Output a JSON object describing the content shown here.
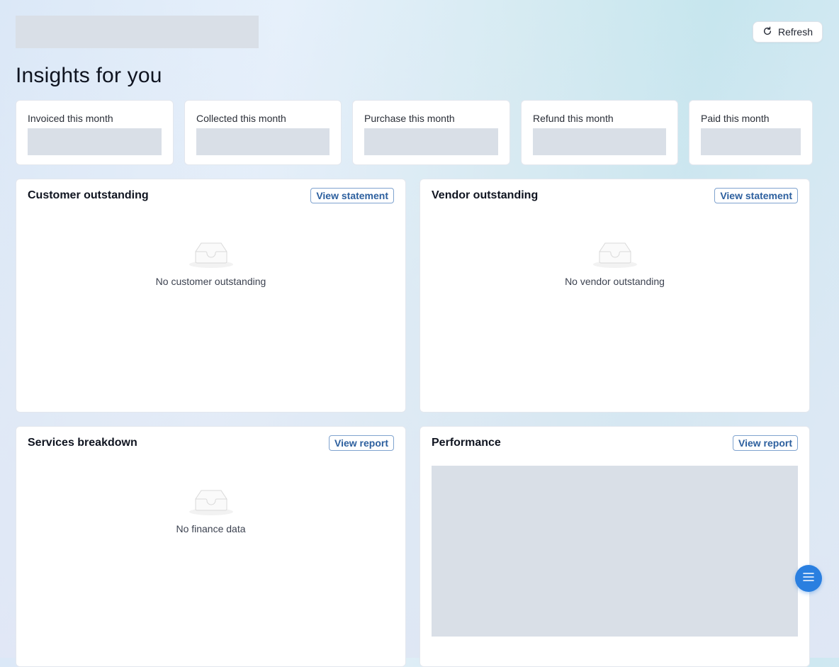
{
  "header": {
    "refresh_label": "Refresh",
    "title": "Insights for you"
  },
  "stats": [
    {
      "label": "Invoiced this month"
    },
    {
      "label": "Collected this month"
    },
    {
      "label": "Purchase this month"
    },
    {
      "label": "Refund this month"
    },
    {
      "label": "Paid this month"
    }
  ],
  "panels": {
    "customer": {
      "title": "Customer outstanding",
      "action": "View statement",
      "empty": "No customer outstanding"
    },
    "vendor": {
      "title": "Vendor outstanding",
      "action": "View statement",
      "empty": "No vendor outstanding"
    },
    "services": {
      "title": "Services breakdown",
      "action": "View report",
      "empty": "No finance data"
    },
    "performance": {
      "title": "Performance",
      "action": "View report"
    }
  },
  "icons": {
    "refresh": "refresh-icon",
    "empty": "empty-inbox-icon",
    "menu": "menu-icon"
  },
  "colors": {
    "accent": "#2a7fe0",
    "link": "#2c5f9e",
    "skeleton": "#d9dfe7"
  }
}
